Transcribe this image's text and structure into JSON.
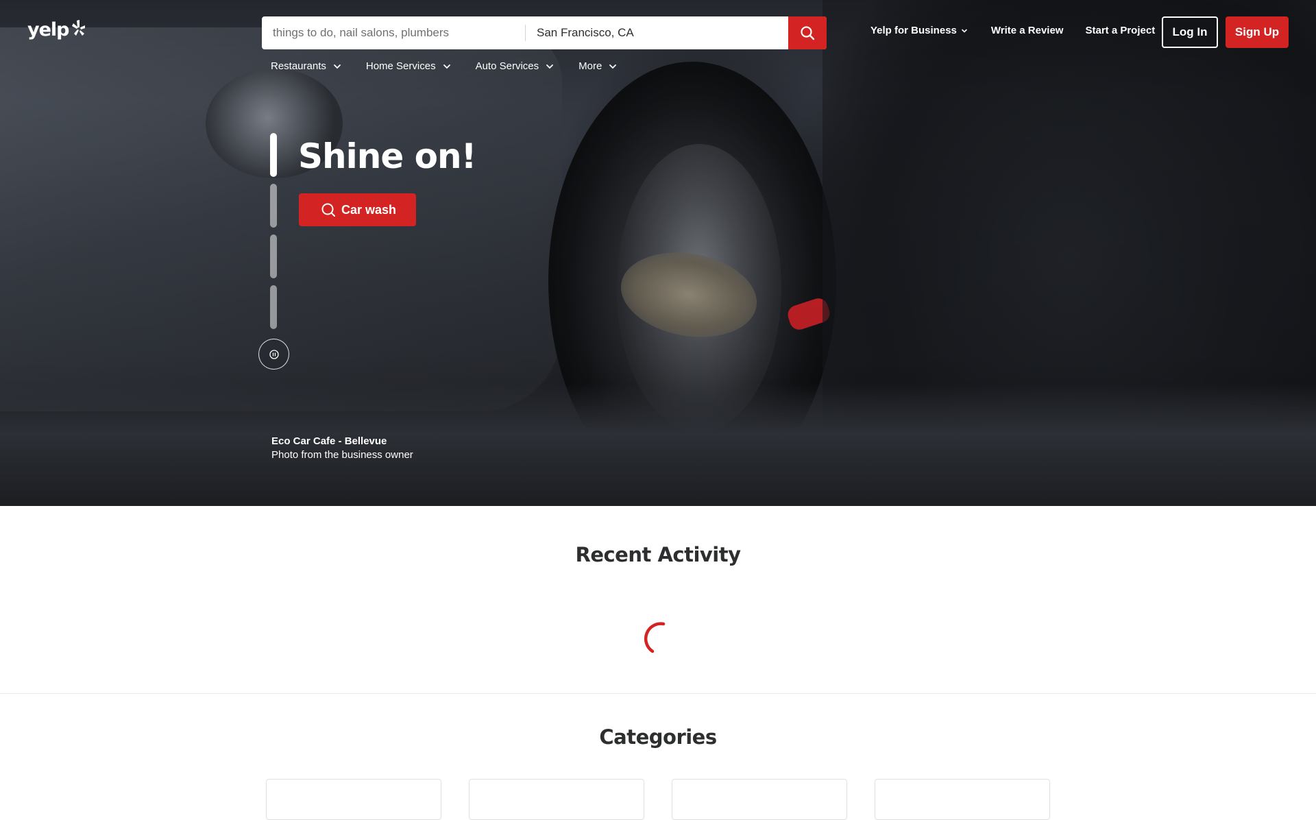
{
  "brand": {
    "logo_text": "yelp",
    "accent": "#d32323"
  },
  "search": {
    "find_placeholder": "things to do, nail salons, plumbers",
    "near_value": "San Francisco, CA",
    "submit_icon": "search-icon"
  },
  "topnav": {
    "business_label": "Yelp for Business",
    "review_label": "Write a Review",
    "project_label": "Start a Project",
    "login_label": "Log In",
    "signup_label": "Sign Up"
  },
  "categories_nav": [
    {
      "label": "Restaurants"
    },
    {
      "label": "Home Services"
    },
    {
      "label": "Auto Services"
    },
    {
      "label": "More"
    }
  ],
  "hero": {
    "headline": "Shine on!",
    "cta_label": "Car wash",
    "cta_icon": "search-icon",
    "slides_progress": [
      1.0,
      0,
      0,
      0
    ],
    "credit_business": "Eco Car Cafe - Bellevue",
    "credit_note": "Photo from the business owner",
    "pause_icon": "pause-icon"
  },
  "recent": {
    "title": "Recent Activity"
  },
  "categories": {
    "title": "Categories"
  }
}
